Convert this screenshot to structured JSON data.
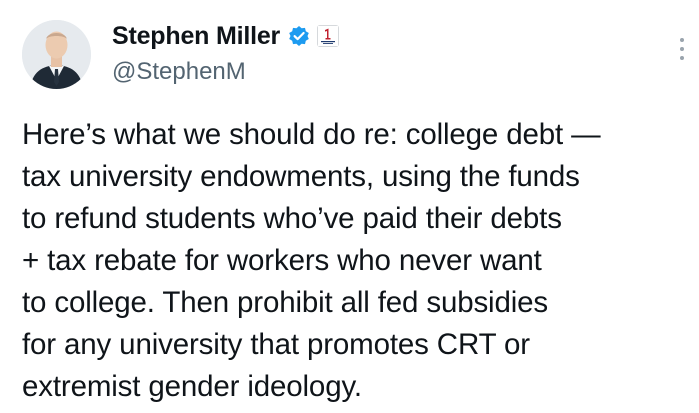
{
  "tweet": {
    "author": {
      "display_name": "Stephen Miller",
      "handle": "@StephenM",
      "avatar_icon": "profile-photo",
      "verified_icon": "verified-badge-icon",
      "affiliate_icon": "affiliate-badge-icon"
    },
    "text": "Here’s what we should do re: college debt —\ntax university endowments, using the funds\nto refund students who’ve paid their debts\n+ tax rebate for workers who never want\nto college. Then prohibit all fed subsidies\nfor any university that promotes CRT or\nextremist gender ideology.",
    "more_icon": "more-options-icon"
  },
  "colors": {
    "text_primary": "#0f1419",
    "text_secondary": "#536471",
    "verified_blue": "#1d9bf0",
    "background": "#ffffff"
  }
}
